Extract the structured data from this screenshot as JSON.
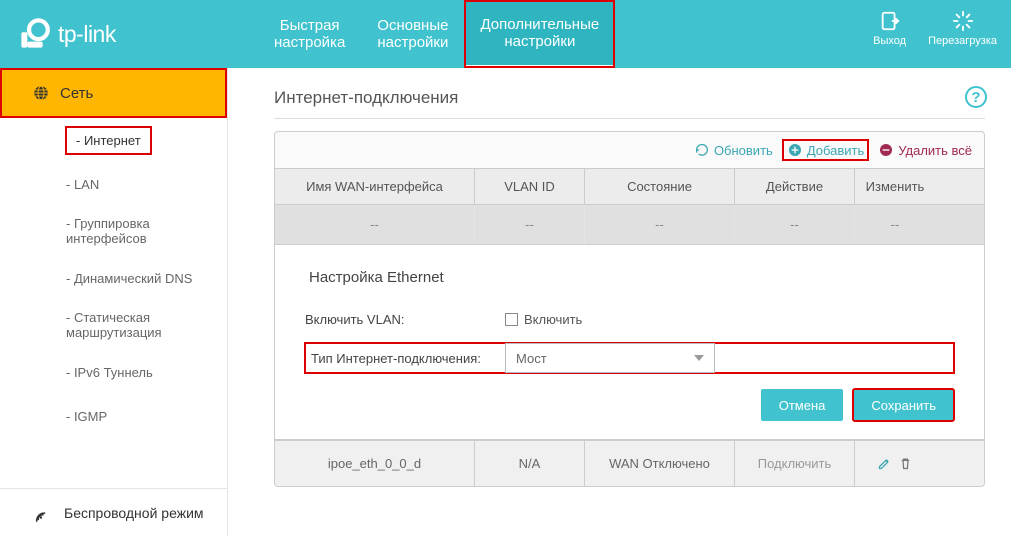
{
  "brand": "tp-link",
  "tabs": {
    "quick": "Быстрая\nнастройка",
    "basic": "Основные\nнастройки",
    "advanced": "Дополнительные\nнастройки"
  },
  "header_actions": {
    "logout": "Выход",
    "reboot": "Перезагрузка"
  },
  "sidebar": {
    "group_network": "Сеть",
    "items": [
      "- Интернет",
      "- LAN",
      "- Группировка\n  интерфейсов",
      "- Динамический DNS",
      "- Статическая\n  маршрутизация",
      "- IPv6 Туннель",
      "- IGMP"
    ],
    "wireless": "Беспроводной режим"
  },
  "content": {
    "title": "Интернет-подключения",
    "actions": {
      "refresh": "Обновить",
      "add": "Добавить",
      "delete_all": "Удалить всё"
    },
    "columns": {
      "wan_name": "Имя WAN-интерфейса",
      "vlan_id": "VLAN ID",
      "state": "Состояние",
      "action": "Действие",
      "edit": "Изменить"
    },
    "dash": "--",
    "form": {
      "title": "Настройка Ethernet",
      "enable_vlan": "Включить VLAN:",
      "enable_check": "Включить",
      "conn_type_label": "Тип Интернет-подключения:",
      "conn_type_value": "Мост",
      "cancel": "Отмена",
      "save": "Сохранить"
    },
    "footer": {
      "wan_name": "ipoe_eth_0_0_d",
      "vlan_id": "N/A",
      "state": "WAN Отключено",
      "action": "Подключить"
    }
  }
}
